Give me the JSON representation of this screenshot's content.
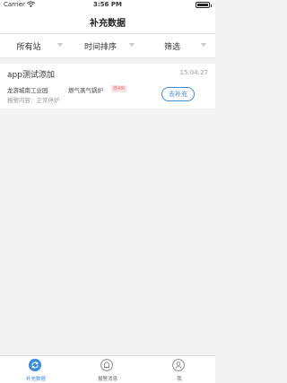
{
  "status_bar": {
    "carrier": "Carrier",
    "time": "3:56 PM"
  },
  "nav": {
    "title": "补充数据"
  },
  "filters": [
    {
      "label": "所有站"
    },
    {
      "label": "时间排序"
    },
    {
      "label": "筛选"
    }
  ],
  "task": {
    "title": "app测试添加",
    "time": "15:04:27",
    "site": "龙游城南工业园",
    "device": "燃气蒸气锅炉",
    "device_badge": "燃48t",
    "alarm": "报警内容：正常停炉",
    "button_label": "去补充"
  },
  "tabbar": {
    "items": [
      {
        "label": "补充数据",
        "icon": "refresh-icon",
        "active": true
      },
      {
        "label": "报警消息",
        "icon": "alarm-icon",
        "active": false
      },
      {
        "label": "我",
        "icon": "profile-icon",
        "active": false
      }
    ]
  },
  "colors": {
    "accent": "#3b8be0",
    "badge_bg": "#fbe3e3",
    "badge_text": "#e07070",
    "background": "#f2f2f2"
  }
}
